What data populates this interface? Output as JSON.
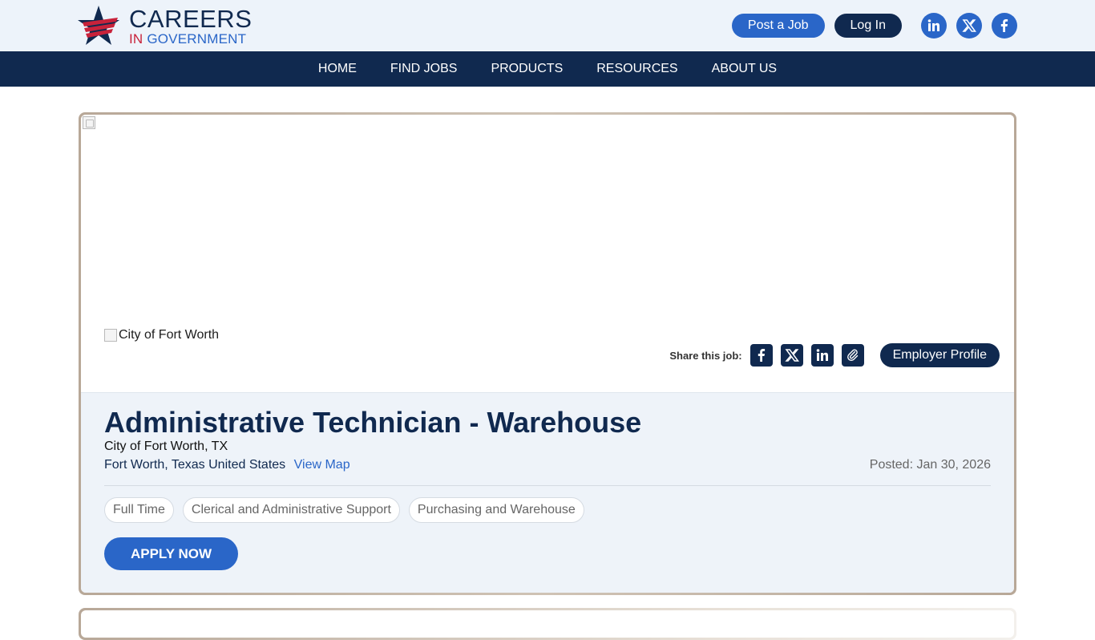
{
  "header": {
    "logo_line1": "CAREERS",
    "logo_line2_prefix": "IN ",
    "logo_line2_suffix": "GOVERNMENT",
    "post_job_label": "Post a Job",
    "login_label": "Log In",
    "social": [
      {
        "icon": "linkedin-icon"
      },
      {
        "icon": "x-icon"
      },
      {
        "icon": "facebook-icon"
      }
    ]
  },
  "nav": {
    "items": [
      {
        "label": "HOME"
      },
      {
        "label": "FIND JOBS"
      },
      {
        "label": "PRODUCTS"
      },
      {
        "label": "RESOURCES"
      },
      {
        "label": "ABOUT US"
      }
    ]
  },
  "job": {
    "employer_logo_alt": "City of Fort Worth",
    "share_label": "Share this job:",
    "share_icons": [
      "facebook-icon",
      "x-icon",
      "linkedin-icon",
      "link-icon"
    ],
    "employer_profile_label": "Employer Profile",
    "title": "Administrative Technician - Warehouse",
    "employer": "City of Fort Worth, TX",
    "location": "Fort Worth, Texas United States",
    "view_map_label": "View Map",
    "posted": "Posted: Jan 30, 2026",
    "tags": [
      "Full Time",
      "Clerical and Administrative Support",
      "Purchasing and Warehouse"
    ],
    "apply_label": "APPLY NOW"
  },
  "colors": {
    "navy": "#10294f",
    "blue": "#2a66c8",
    "red": "#c8223a",
    "details_bg": "#eef3f9"
  }
}
